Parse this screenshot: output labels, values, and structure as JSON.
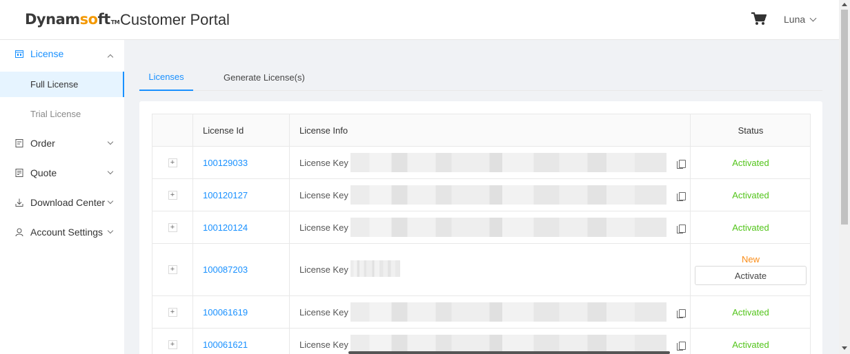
{
  "header": {
    "logo_text_a": "Dynam",
    "logo_text_b": "s",
    "logo_text_c": "ft",
    "logo_tm": "TM",
    "title": "Customer Portal",
    "user": "Luna"
  },
  "sidebar": {
    "items": [
      {
        "label": "License",
        "icon": "license-icon"
      },
      {
        "label": "Order",
        "icon": "order-icon"
      },
      {
        "label": "Quote",
        "icon": "quote-icon"
      },
      {
        "label": "Download Center",
        "icon": "download-icon"
      },
      {
        "label": "Account Settings",
        "icon": "user-icon"
      }
    ],
    "sub_items": [
      {
        "label": "Full License"
      },
      {
        "label": "Trial License"
      }
    ]
  },
  "tabs": [
    {
      "label": "Licenses"
    },
    {
      "label": "Generate License(s)"
    }
  ],
  "table": {
    "headers": {
      "id": "License Id",
      "info": "License Info",
      "status": "Status"
    },
    "rows": [
      {
        "id": "100129033",
        "info": "License Key",
        "status": "Activated"
      },
      {
        "id": "100120127",
        "info": "License Key",
        "status": "Activated"
      },
      {
        "id": "100120124",
        "info": "License Key",
        "status": "Activated"
      },
      {
        "id": "100087203",
        "info": "License Key",
        "status": "New",
        "action": "Activate"
      },
      {
        "id": "100061619",
        "info": "License Key",
        "status": "Activated"
      },
      {
        "id": "100061621",
        "info": "License Key",
        "status": "Activated"
      }
    ],
    "expand_symbol": "+"
  }
}
